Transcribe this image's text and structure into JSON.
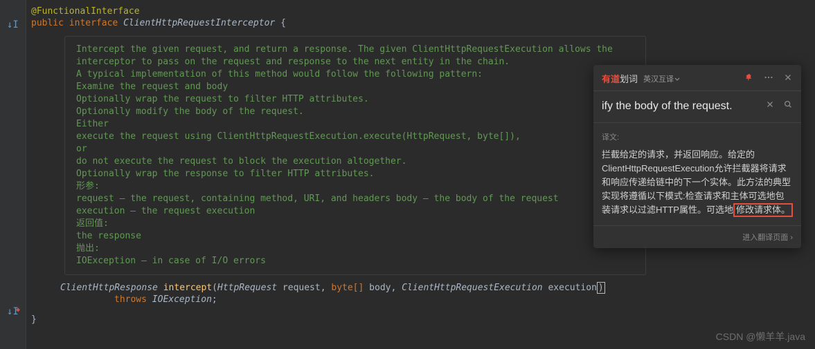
{
  "code": {
    "annotation": "@FunctionalInterface",
    "decl_public": "public",
    "decl_interface": "interface",
    "decl_name": "ClientHttpRequestInterceptor",
    "brace_open": "{",
    "brace_close": "}",
    "javadoc_lines": [
      "Intercept the given request, and return a response. The given ClientHttpRequestExecution allows the",
      "interceptor to pass on the request and response to the next entity in the chain.",
      "A typical implementation of this method would follow the following pattern:",
      "Examine the request and body",
      "Optionally wrap the request to filter HTTP attributes.",
      "Optionally modify the body of the request.",
      "Either",
      "execute the request using ClientHttpRequestExecution.execute(HttpRequest, byte[]),",
      "or",
      "do not execute the request to block the execution altogether.",
      "Optionally wrap the response to filter HTTP attributes.",
      "形参:",
      "request – the request, containing method, URI, and headers body – the body of the request",
      "execution – the request execution",
      "返回值:",
      "the response",
      "抛出:",
      "IOException – in case of I/O errors"
    ],
    "sig": {
      "return_type": "ClientHttpResponse",
      "method_name": "intercept",
      "param1_type": "HttpRequest",
      "param1_name": "request",
      "param2_type": "byte[]",
      "param2_name": "body",
      "param3_type": "ClientHttpRequestExecution",
      "param3_name": "execution",
      "throws_kw": "throws",
      "throws_type": "IOException"
    }
  },
  "translator": {
    "logo_prefix": "有道",
    "logo_suffix": "划词",
    "lang_pair": "英汉互译",
    "query_text": "ify the body of the request.",
    "label": "译文:",
    "translation_main": "拦截给定的请求，并返回响应。给定的ClientHttpRequestExecution允许拦截器将请求和响应传递给链中的下一个实体。此方法的典型实现将遵循以下模式:检查请求和主体可选地包装请求以过滤HTTP属性。可选地",
    "translation_highlight": "修改请求体。",
    "footer_link": "进入翻译页面"
  },
  "watermark": "CSDN @懒羊羊.java"
}
